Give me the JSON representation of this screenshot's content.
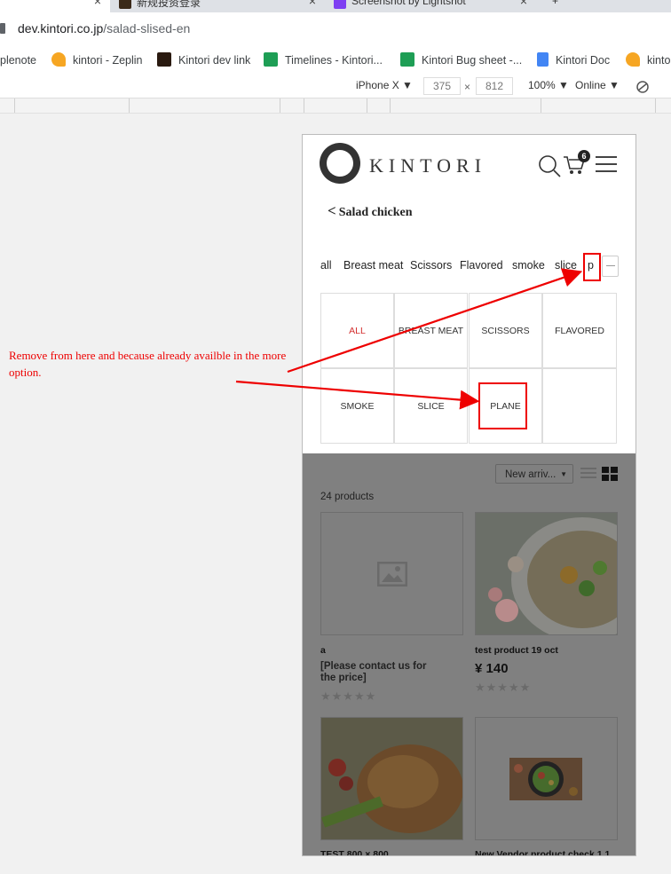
{
  "browser": {
    "tabs": [
      {
        "title": "新规投资登录",
        "close": "×"
      },
      {
        "title": "Screenshot by Lightshot",
        "close": "×"
      },
      {
        "title": "+"
      }
    ],
    "url_host": "dev.kintori.co.jp",
    "url_path": "/salad-slised-en",
    "bookmarks": [
      {
        "label": "plenote",
        "icon": "note-icon"
      },
      {
        "label": "kintori - Zeplin",
        "icon": "zeplin-icon"
      },
      {
        "label": "Kintori dev link",
        "icon": "kintori-icon"
      },
      {
        "label": "Timelines - Kintori...",
        "icon": "sheets-icon"
      },
      {
        "label": "Kintori Bug sheet -...",
        "icon": "sheets-icon"
      },
      {
        "label": "Kintori Doc",
        "icon": "docs-icon"
      },
      {
        "label": "kinto",
        "icon": "zeplin-icon"
      }
    ],
    "device_toolbar": {
      "device": "iPhone X ▼",
      "width": "375",
      "times": "×",
      "height": "812",
      "zoom": "100% ▼",
      "network": "Online ▼"
    }
  },
  "site": {
    "logo_text": "KINTORI",
    "cart_count": "6",
    "page_title": "Salad chicken",
    "back_glyph": "<",
    "filter_chips": [
      "all",
      "Breast meat",
      "Scissors",
      "Flavored",
      "smoke",
      "slice",
      "p"
    ],
    "categories": [
      "ALL",
      "BREAST MEAT",
      "SCISSORS",
      "FLAVORED",
      "SMOKE",
      "SLICE",
      "PLANE",
      ""
    ],
    "sort_label": "New arriv...",
    "sort_caret": "▼",
    "product_count": "24 products",
    "products": [
      {
        "name": "a",
        "price": "[Please contact us for the price]",
        "stars": "★★★★★"
      },
      {
        "name": "test product 19 oct",
        "price": "¥ 140",
        "stars": "★★★★★"
      },
      {
        "name": "TEST 800 × 800",
        "price": ""
      },
      {
        "name": "New Vendor product check 1.1",
        "price": ""
      }
    ]
  },
  "annotation": {
    "text": "Remove from here and because already availble in the more option.",
    "color": "#e00000"
  },
  "colors": {
    "accent_red": "#d32f2f",
    "overlay": "#808080"
  }
}
